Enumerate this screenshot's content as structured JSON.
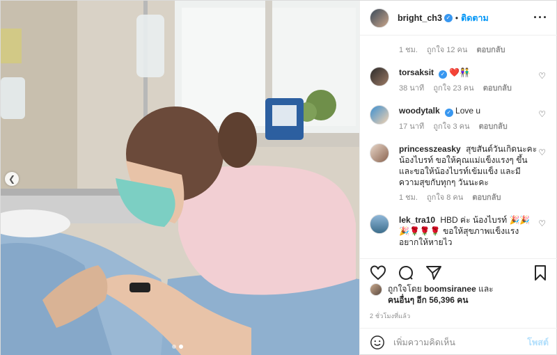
{
  "header": {
    "username": "bright_ch3",
    "separator": "•",
    "follow_label": "ติดตาม",
    "more_label": "···"
  },
  "first_comment_meta": {
    "time": "1 ชม.",
    "likes": "ถูกใจ 12 คน",
    "reply": "ตอบกลับ"
  },
  "comments": [
    {
      "username": "torsaksit",
      "text": "❤️👫",
      "time": "38 นาที",
      "likes": "ถูกใจ 23 คน",
      "reply": "ตอบกลับ"
    },
    {
      "username": "woodytalk",
      "text": "Love u",
      "time": "17 นาที",
      "likes": "ถูกใจ 3 คน",
      "reply": "ตอบกลับ"
    },
    {
      "username": "princesszeasky",
      "text": "สุขสันต์วันเกิดนะคะน้องไบรท์ ขอให้คุณแม่แข็งแรงๆ ขึ้นและขอให้น้องไบรท์เข้มแข็ง และมีความสุขกับทุกๆ วันนะคะ",
      "time": "1 ชม.",
      "likes": "ถูกใจ 8 คน",
      "reply": "ตอบกลับ"
    },
    {
      "username": "lek_tra10",
      "text": "HBD ค่ะ น้องไบรท์ 🎉🎉 🎉🌹🌹🌹 ขอให้สุขภาพแข็งแรง อยากให้หายไว",
      "time": "",
      "likes": "",
      "reply": ""
    }
  ],
  "likes": {
    "prefix": "ถูกใจโดย",
    "liker": "boomsiranee",
    "middle": "และ",
    "others": "คนอื่นๆ อีก 56,396 คน"
  },
  "timestamp": "2 ชั่วโมงที่แล้ว",
  "add_comment": {
    "placeholder": "เพิ่มความคิดเห็น",
    "post_label": "โพสต์"
  },
  "carousel": {
    "prev_icon": "chevron-left-icon",
    "page": 2,
    "total": 2
  },
  "colors": {
    "accent": "#0095f6",
    "post_disabled": "#b2dffc",
    "heart": "#ed4956"
  }
}
